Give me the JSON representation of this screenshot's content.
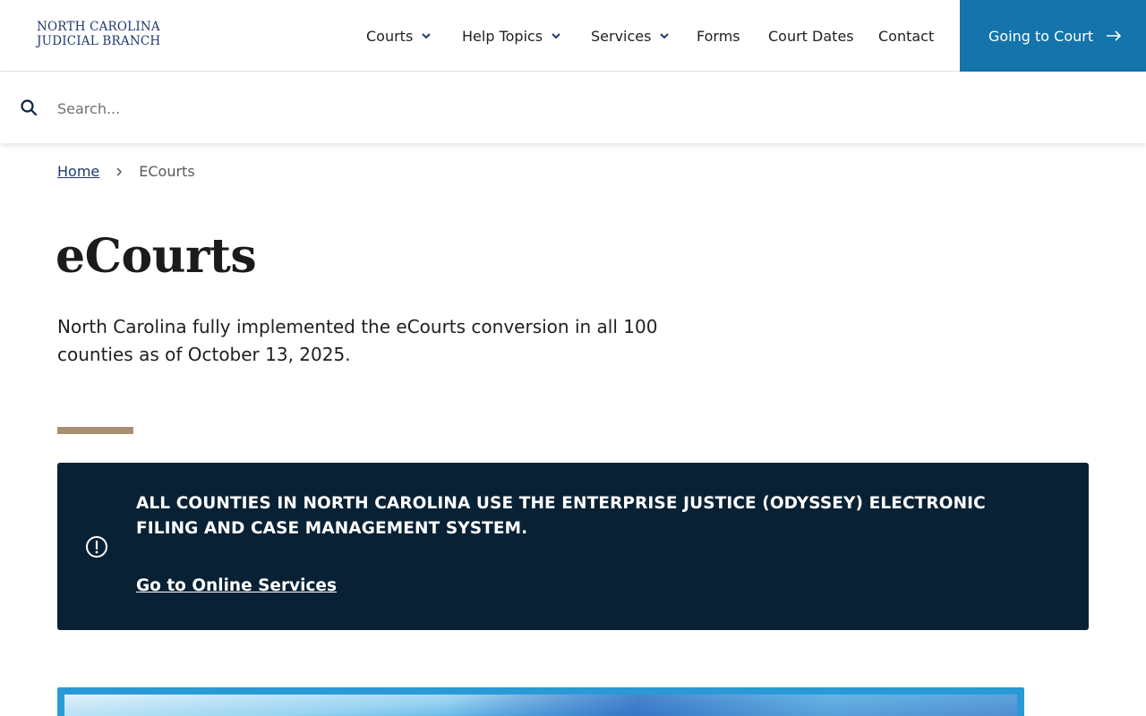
{
  "header": {
    "logo_line1": "NORTH CAROLINA",
    "logo_line2": "JUDICIAL BRANCH",
    "nav": [
      {
        "label": "Courts"
      },
      {
        "label": "Help Topics"
      },
      {
        "label": "Services"
      },
      {
        "label": "Forms"
      },
      {
        "label": "Court Dates"
      },
      {
        "label": "Contact"
      }
    ],
    "cta_label": "Going to Court"
  },
  "search": {
    "placeholder": "Search...",
    "value": ""
  },
  "breadcrumb": {
    "home": "Home",
    "current": "ECourts"
  },
  "page": {
    "title": "eCourts",
    "intro": "North Carolina fully implemented the eCourts conversion in all 100 counties as of October 13, 2025."
  },
  "alert": {
    "text": "All counties in North Carolina use the Enterprise Justice (Odyssey) electronic filing and case management system.",
    "link": "Go to Online Services"
  },
  "colors": {
    "brand_navy": "#1e3a6e",
    "cta_blue": "#1474ab",
    "alert_bg": "#082135",
    "accent_tan": "#a89070"
  },
  "icons": {
    "search": "search-icon",
    "chevron": "chevron-down-icon",
    "arrow": "arrow-right-icon",
    "alert": "alert-circle-icon"
  }
}
